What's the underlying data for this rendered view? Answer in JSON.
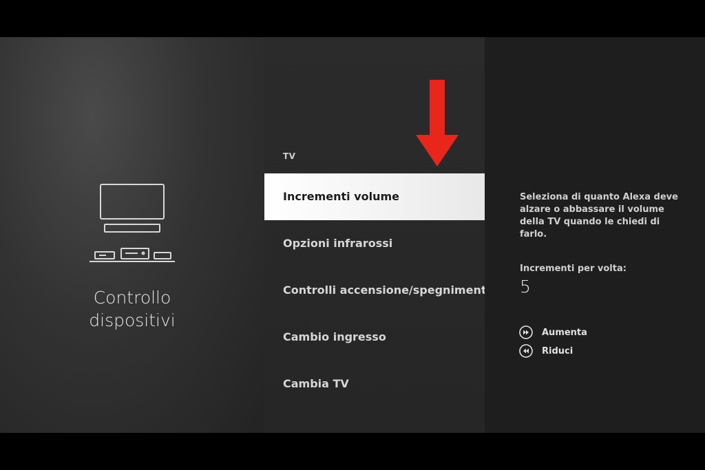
{
  "left_panel": {
    "icon": "tv-devices-icon",
    "title_line1": "Controllo",
    "title_line2": "dispositivi"
  },
  "middle_panel": {
    "section_label": "TV",
    "items": [
      {
        "label": "Incrementi volume",
        "selected": true
      },
      {
        "label": "Opzioni infrarossi",
        "selected": false
      },
      {
        "label": "Controlli accensione/spegnimento",
        "selected": false
      },
      {
        "label": "Cambio ingresso",
        "selected": false
      },
      {
        "label": "Cambia TV",
        "selected": false
      }
    ]
  },
  "annotation": {
    "icon": "red-down-arrow-icon",
    "color": "#e8261c"
  },
  "right_panel": {
    "description": "Seleziona di quanto Alexa deve alzare o abbassare il volume della TV quando le chiedi di farlo.",
    "increments_label": "Incrementi per volta:",
    "increments_value": "5",
    "controls": [
      {
        "icon": "fast-forward-icon",
        "label": "Aumenta"
      },
      {
        "icon": "rewind-icon",
        "label": "Riduci"
      }
    ]
  }
}
